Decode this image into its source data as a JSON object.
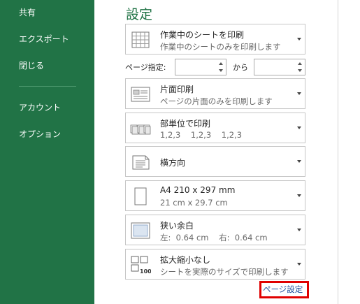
{
  "sidebar": {
    "items": [
      "共有",
      "エクスポート",
      "閉じる",
      "アカウント",
      "オプション"
    ]
  },
  "title": "設定",
  "print_what": {
    "title": "作業中のシートを印刷",
    "subtitle": "作業中のシートのみを印刷します",
    "icon": "sheet-grid-icon"
  },
  "pages": {
    "label": "ページ指定:",
    "to_label": "から",
    "from_value": "",
    "to_value": ""
  },
  "sides": {
    "title": "片面印刷",
    "subtitle": "ページの片面のみを印刷します",
    "icon": "one-sided-icon"
  },
  "collate": {
    "title": "部単位で印刷",
    "subtitle": "1,2,3    1,2,3    1,2,3",
    "icon": "collated-icon"
  },
  "orientation": {
    "title": "横方向",
    "icon": "landscape-icon"
  },
  "paper": {
    "title": "A4 210 x 297 mm",
    "subtitle": "21 cm x 29.7 cm",
    "icon": "paper-size-icon"
  },
  "margins": {
    "title": "狭い余白",
    "subtitle": "左:  0.64 cm    右:  0.64 cm",
    "icon": "margins-icon"
  },
  "scaling": {
    "title": "拡大縮小なし",
    "subtitle": "シートを実際のサイズで印刷します",
    "icon": "scaling-icon",
    "icon_text": "100"
  },
  "page_setup_link": "ページ設定",
  "colors": {
    "accent": "#217346",
    "highlight": "#e00000",
    "link": "#1f4e9c"
  }
}
